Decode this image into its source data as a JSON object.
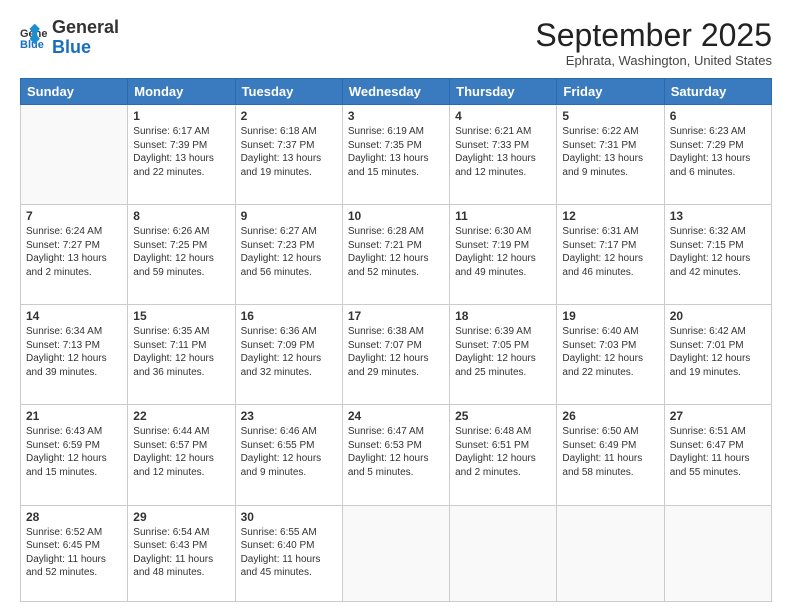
{
  "header": {
    "logo_general": "General",
    "logo_blue": "Blue",
    "month_title": "September 2025",
    "subtitle": "Ephrata, Washington, United States"
  },
  "days_of_week": [
    "Sunday",
    "Monday",
    "Tuesday",
    "Wednesday",
    "Thursday",
    "Friday",
    "Saturday"
  ],
  "weeks": [
    [
      {
        "day": "",
        "text": ""
      },
      {
        "day": "1",
        "text": "Sunrise: 6:17 AM\nSunset: 7:39 PM\nDaylight: 13 hours\nand 22 minutes."
      },
      {
        "day": "2",
        "text": "Sunrise: 6:18 AM\nSunset: 7:37 PM\nDaylight: 13 hours\nand 19 minutes."
      },
      {
        "day": "3",
        "text": "Sunrise: 6:19 AM\nSunset: 7:35 PM\nDaylight: 13 hours\nand 15 minutes."
      },
      {
        "day": "4",
        "text": "Sunrise: 6:21 AM\nSunset: 7:33 PM\nDaylight: 13 hours\nand 12 minutes."
      },
      {
        "day": "5",
        "text": "Sunrise: 6:22 AM\nSunset: 7:31 PM\nDaylight: 13 hours\nand 9 minutes."
      },
      {
        "day": "6",
        "text": "Sunrise: 6:23 AM\nSunset: 7:29 PM\nDaylight: 13 hours\nand 6 minutes."
      }
    ],
    [
      {
        "day": "7",
        "text": "Sunrise: 6:24 AM\nSunset: 7:27 PM\nDaylight: 13 hours\nand 2 minutes."
      },
      {
        "day": "8",
        "text": "Sunrise: 6:26 AM\nSunset: 7:25 PM\nDaylight: 12 hours\nand 59 minutes."
      },
      {
        "day": "9",
        "text": "Sunrise: 6:27 AM\nSunset: 7:23 PM\nDaylight: 12 hours\nand 56 minutes."
      },
      {
        "day": "10",
        "text": "Sunrise: 6:28 AM\nSunset: 7:21 PM\nDaylight: 12 hours\nand 52 minutes."
      },
      {
        "day": "11",
        "text": "Sunrise: 6:30 AM\nSunset: 7:19 PM\nDaylight: 12 hours\nand 49 minutes."
      },
      {
        "day": "12",
        "text": "Sunrise: 6:31 AM\nSunset: 7:17 PM\nDaylight: 12 hours\nand 46 minutes."
      },
      {
        "day": "13",
        "text": "Sunrise: 6:32 AM\nSunset: 7:15 PM\nDaylight: 12 hours\nand 42 minutes."
      }
    ],
    [
      {
        "day": "14",
        "text": "Sunrise: 6:34 AM\nSunset: 7:13 PM\nDaylight: 12 hours\nand 39 minutes."
      },
      {
        "day": "15",
        "text": "Sunrise: 6:35 AM\nSunset: 7:11 PM\nDaylight: 12 hours\nand 36 minutes."
      },
      {
        "day": "16",
        "text": "Sunrise: 6:36 AM\nSunset: 7:09 PM\nDaylight: 12 hours\nand 32 minutes."
      },
      {
        "day": "17",
        "text": "Sunrise: 6:38 AM\nSunset: 7:07 PM\nDaylight: 12 hours\nand 29 minutes."
      },
      {
        "day": "18",
        "text": "Sunrise: 6:39 AM\nSunset: 7:05 PM\nDaylight: 12 hours\nand 25 minutes."
      },
      {
        "day": "19",
        "text": "Sunrise: 6:40 AM\nSunset: 7:03 PM\nDaylight: 12 hours\nand 22 minutes."
      },
      {
        "day": "20",
        "text": "Sunrise: 6:42 AM\nSunset: 7:01 PM\nDaylight: 12 hours\nand 19 minutes."
      }
    ],
    [
      {
        "day": "21",
        "text": "Sunrise: 6:43 AM\nSunset: 6:59 PM\nDaylight: 12 hours\nand 15 minutes."
      },
      {
        "day": "22",
        "text": "Sunrise: 6:44 AM\nSunset: 6:57 PM\nDaylight: 12 hours\nand 12 minutes."
      },
      {
        "day": "23",
        "text": "Sunrise: 6:46 AM\nSunset: 6:55 PM\nDaylight: 12 hours\nand 9 minutes."
      },
      {
        "day": "24",
        "text": "Sunrise: 6:47 AM\nSunset: 6:53 PM\nDaylight: 12 hours\nand 5 minutes."
      },
      {
        "day": "25",
        "text": "Sunrise: 6:48 AM\nSunset: 6:51 PM\nDaylight: 12 hours\nand 2 minutes."
      },
      {
        "day": "26",
        "text": "Sunrise: 6:50 AM\nSunset: 6:49 PM\nDaylight: 11 hours\nand 58 minutes."
      },
      {
        "day": "27",
        "text": "Sunrise: 6:51 AM\nSunset: 6:47 PM\nDaylight: 11 hours\nand 55 minutes."
      }
    ],
    [
      {
        "day": "28",
        "text": "Sunrise: 6:52 AM\nSunset: 6:45 PM\nDaylight: 11 hours\nand 52 minutes."
      },
      {
        "day": "29",
        "text": "Sunrise: 6:54 AM\nSunset: 6:43 PM\nDaylight: 11 hours\nand 48 minutes."
      },
      {
        "day": "30",
        "text": "Sunrise: 6:55 AM\nSunset: 6:40 PM\nDaylight: 11 hours\nand 45 minutes."
      },
      {
        "day": "",
        "text": ""
      },
      {
        "day": "",
        "text": ""
      },
      {
        "day": "",
        "text": ""
      },
      {
        "day": "",
        "text": ""
      }
    ]
  ]
}
